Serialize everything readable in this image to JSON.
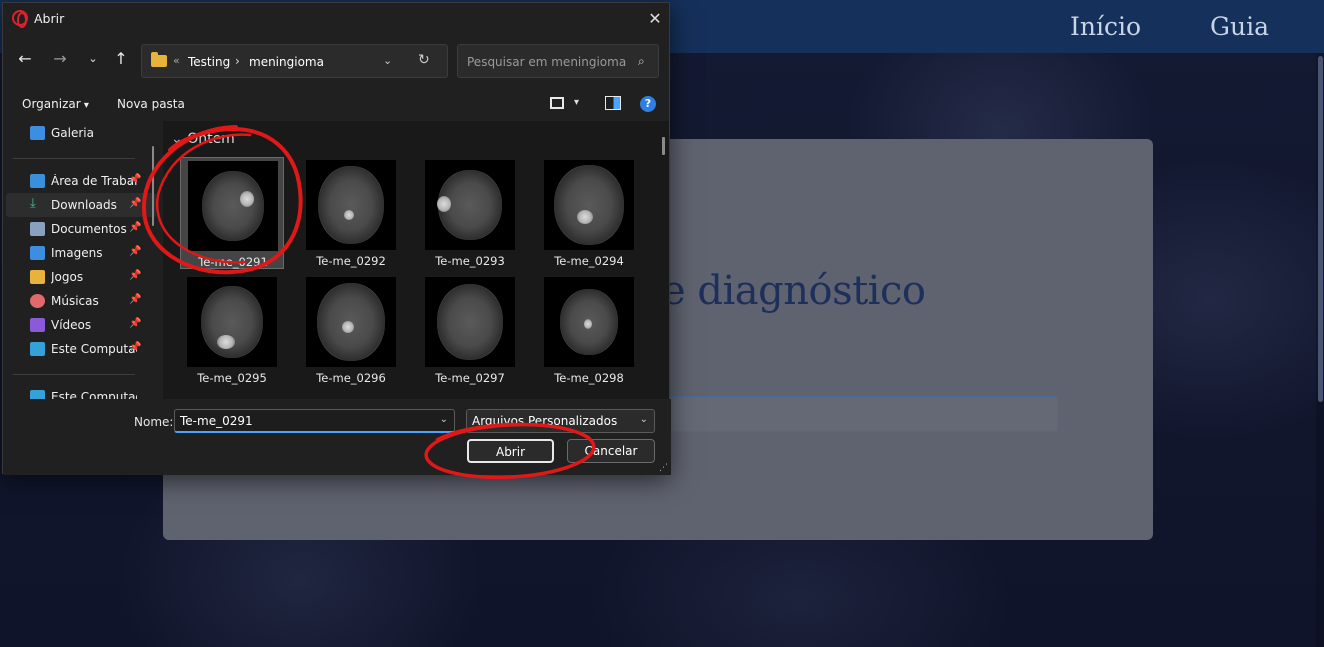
{
  "website": {
    "nav": {
      "inicio": "Início",
      "guia": "Guia"
    },
    "card_title_fragment": "e diagnóstico"
  },
  "dialog": {
    "title": "Abrir",
    "address": {
      "crumbs": [
        "Testing",
        "meningioma"
      ]
    },
    "search_placeholder": "Pesquisar em meningioma",
    "toolbar": {
      "organize": "Organizar",
      "new_folder": "Nova pasta"
    },
    "sidebar": {
      "items": [
        {
          "label": "Galeria",
          "icon": "gallery-icon",
          "pinned": false
        },
        {
          "label": "Área de Trabalho",
          "icon": "desktop-icon",
          "pinned": true
        },
        {
          "label": "Downloads",
          "icon": "download-icon",
          "pinned": true,
          "selected": true
        },
        {
          "label": "Documentos",
          "icon": "documents-icon",
          "pinned": true
        },
        {
          "label": "Imagens",
          "icon": "pictures-icon",
          "pinned": true
        },
        {
          "label": "Jogos",
          "icon": "folder-icon",
          "pinned": true
        },
        {
          "label": "Músicas",
          "icon": "music-icon",
          "pinned": true
        },
        {
          "label": "Vídeos",
          "icon": "videos-icon",
          "pinned": true
        },
        {
          "label": "Este Computador",
          "icon": "computer-icon",
          "pinned": true
        },
        {
          "label": "Este Computador",
          "icon": "computer-icon",
          "pinned": false
        }
      ]
    },
    "group_header": "Ontem",
    "files": [
      {
        "name": "Te-me_0291",
        "selected": true
      },
      {
        "name": "Te-me_0292"
      },
      {
        "name": "Te-me_0293"
      },
      {
        "name": "Te-me_0294"
      },
      {
        "name": "Te-me_0295"
      },
      {
        "name": "Te-me_0296"
      },
      {
        "name": "Te-me_0297"
      },
      {
        "name": "Te-me_0298"
      }
    ],
    "filename_label": "Nome:",
    "filename_value": "Te-me_0291",
    "file_type": "Arquivos Personalizados",
    "buttons": {
      "open": "Abrir",
      "cancel": "Cancelar"
    }
  },
  "colors": {
    "accent": "#4aa3ff",
    "annotation": "#e01818",
    "nav_bar": "#15305a"
  }
}
